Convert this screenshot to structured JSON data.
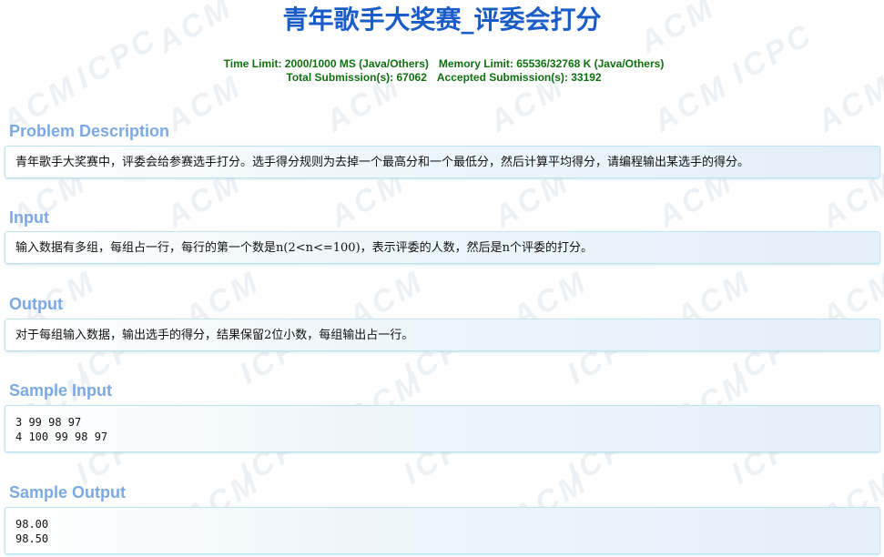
{
  "problem": {
    "title": "青年歌手大奖赛_评委会打分",
    "limits_line1_a": "Time Limit: 2000/1000 MS (Java/Others)",
    "limits_line1_b": "Memory Limit: 65536/32768 K (Java/Others)",
    "limits_line2_a": "Total Submission(s): 67062",
    "limits_line2_b": "Accepted Submission(s): 33192"
  },
  "sections": {
    "description": {
      "heading": "Problem Description",
      "body": "青年歌手大奖赛中，评委会给参赛选手打分。选手得分规则为去掉一个最高分和一个最低分，然后计算平均得分，请编程输出某选手的得分。"
    },
    "input": {
      "heading": "Input",
      "body": "输入数据有多组，每组占一行，每行的第一个数是n(2<n<=100)，表示评委的人数，然后是n个评委的打分。"
    },
    "output": {
      "heading": "Output",
      "body": "对于每组输入数据，输出选手的得分，结果保留2位小数，每组输出占一行。"
    },
    "sample_input": {
      "heading": "Sample Input",
      "body": "3 99 98 97\n4 100 99 98 97"
    },
    "sample_output": {
      "heading": "Sample Output",
      "body": "98.00\n98.50"
    }
  },
  "watermark": {
    "acm": "ACM",
    "icpc": "ICPC"
  },
  "colors": {
    "title": "#1a5cc8",
    "limits": "#107010",
    "section_heading": "#7ca9e3",
    "panel_border": "#bde4f1"
  }
}
